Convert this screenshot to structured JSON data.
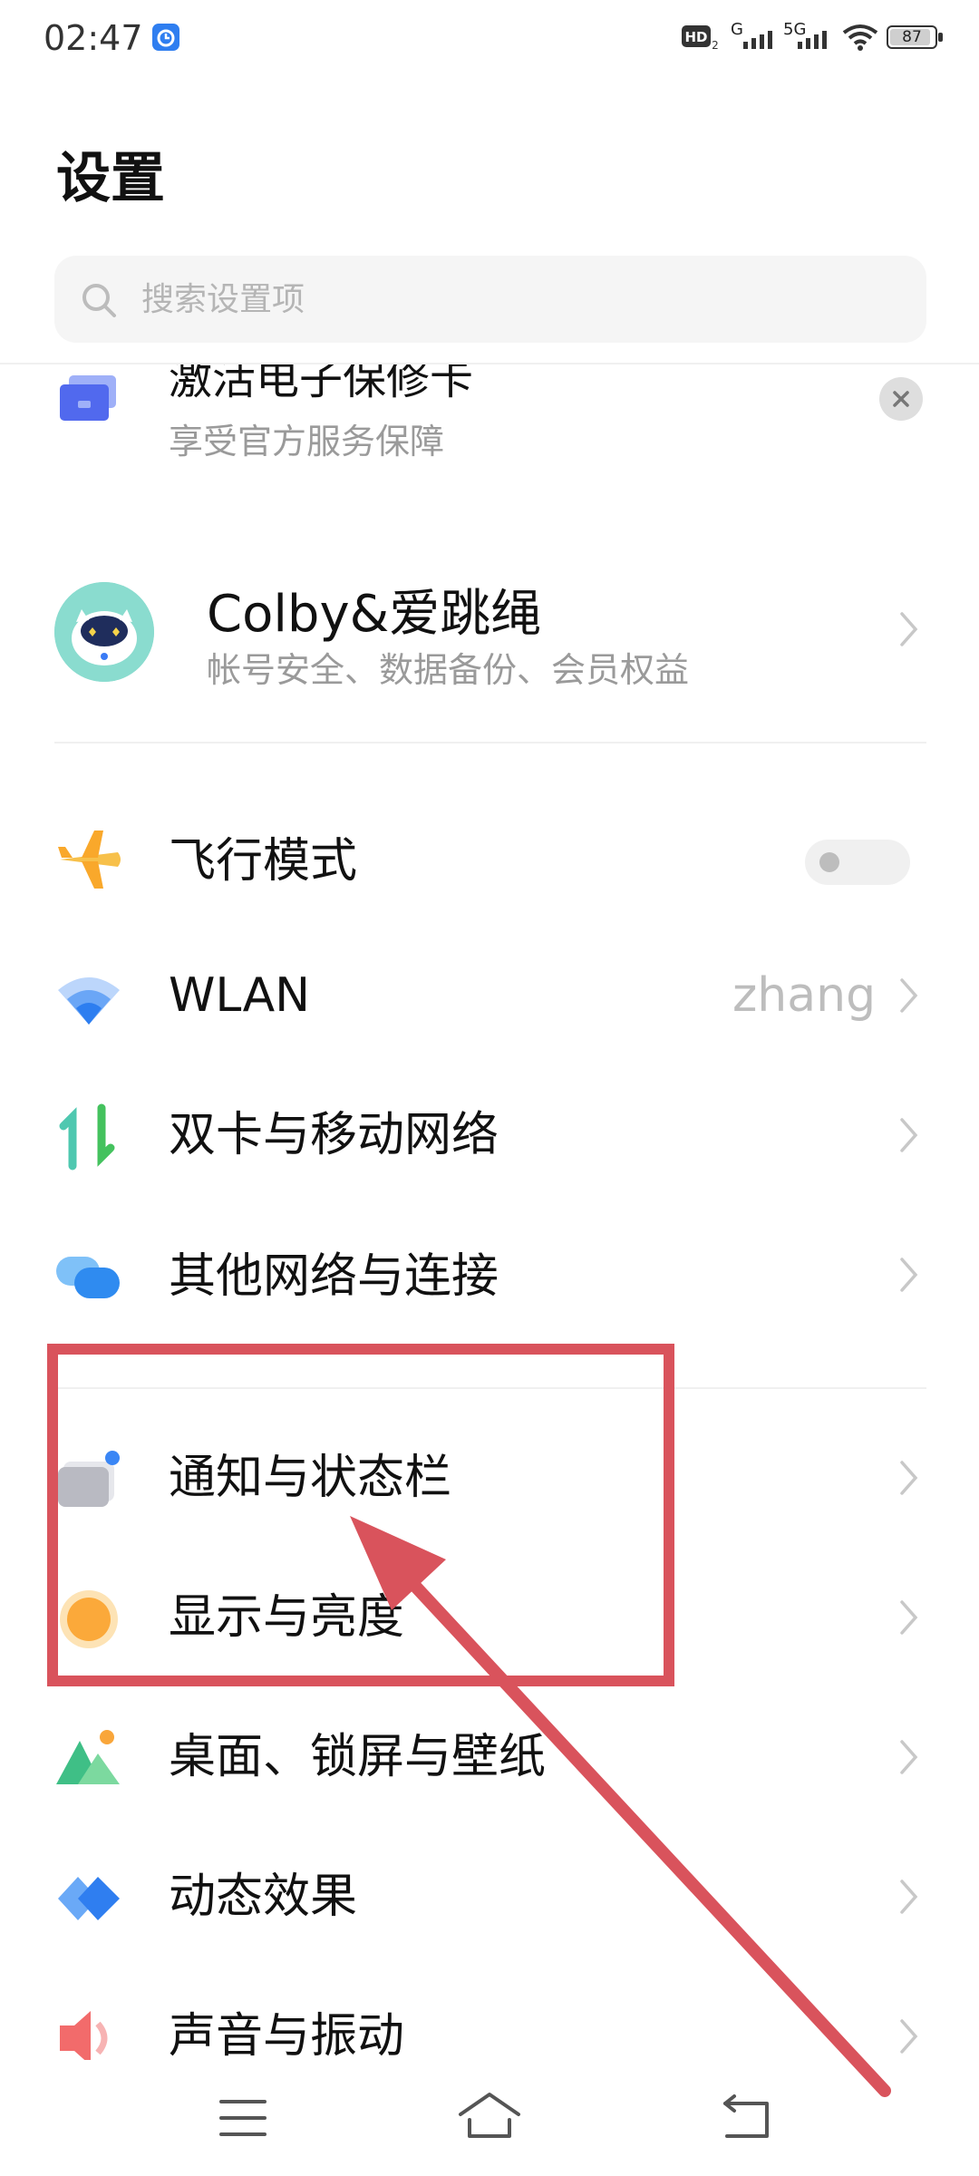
{
  "status_bar": {
    "time": "02:47",
    "icons": [
      "alarm-icon",
      "hd-icon",
      "signal-icon",
      "wifi-icon",
      "battery-icon"
    ],
    "network_1": "G",
    "network_2": "5G",
    "battery": "87"
  },
  "header": {
    "title": "设置"
  },
  "search": {
    "placeholder": "搜索设置项"
  },
  "promo": {
    "title": "激活电子保修卡",
    "subtitle": "享受官方服务保障"
  },
  "account": {
    "name": "Colby&爱跳绳",
    "subtitle": "帐号安全、数据备份、会员权益"
  },
  "settings": {
    "airplane": {
      "label": "飞行模式",
      "enabled": false
    },
    "wlan": {
      "label": "WLAN",
      "value": "zhang"
    },
    "sim": {
      "label": "双卡与移动网络"
    },
    "other_network": {
      "label": "其他网络与连接"
    },
    "notifications": {
      "label": "通知与状态栏"
    },
    "display": {
      "label": "显示与亮度"
    },
    "wallpaper": {
      "label": "桌面、锁屏与壁纸"
    },
    "animation": {
      "label": "动态效果"
    },
    "sound": {
      "label": "声音与振动"
    }
  },
  "nav": {
    "icons": [
      "menu-icon",
      "home-icon",
      "back-icon"
    ]
  },
  "colors": {
    "annotation": "#d9535c",
    "accent_blue": "#3a7bf5",
    "secondary_text": "#9a9a9a"
  }
}
